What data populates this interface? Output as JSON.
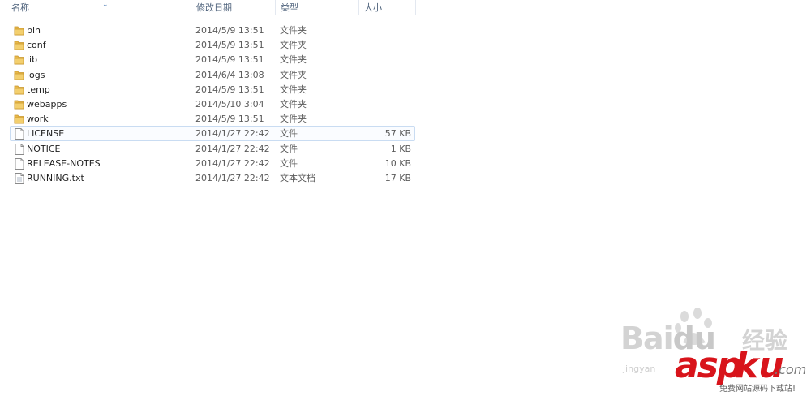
{
  "columns": {
    "name": "名称",
    "date": "修改日期",
    "type": "类型",
    "size": "大小"
  },
  "files": [
    {
      "name": "bin",
      "date": "2014/5/9 13:51",
      "type": "文件夹",
      "size": "",
      "icon": "folder-icon"
    },
    {
      "name": "conf",
      "date": "2014/5/9 13:51",
      "type": "文件夹",
      "size": "",
      "icon": "folder-icon"
    },
    {
      "name": "lib",
      "date": "2014/5/9 13:51",
      "type": "文件夹",
      "size": "",
      "icon": "folder-icon"
    },
    {
      "name": "logs",
      "date": "2014/6/4 13:08",
      "type": "文件夹",
      "size": "",
      "icon": "folder-icon"
    },
    {
      "name": "temp",
      "date": "2014/5/9 13:51",
      "type": "文件夹",
      "size": "",
      "icon": "folder-icon"
    },
    {
      "name": "webapps",
      "date": "2014/5/10 3:04",
      "type": "文件夹",
      "size": "",
      "icon": "folder-icon"
    },
    {
      "name": "work",
      "date": "2014/5/9 13:51",
      "type": "文件夹",
      "size": "",
      "icon": "folder-icon"
    },
    {
      "name": "LICENSE",
      "date": "2014/1/27 22:42",
      "type": "文件",
      "size": "57 KB",
      "icon": "file-icon",
      "selected": true
    },
    {
      "name": "NOTICE",
      "date": "2014/1/27 22:42",
      "type": "文件",
      "size": "1 KB",
      "icon": "file-icon"
    },
    {
      "name": "RELEASE-NOTES",
      "date": "2014/1/27 22:42",
      "type": "文件",
      "size": "10 KB",
      "icon": "file-icon"
    },
    {
      "name": "RUNNING.txt",
      "date": "2014/1/27 22:42",
      "type": "文本文档",
      "size": "17 KB",
      "icon": "text-document-icon"
    }
  ],
  "watermark": {
    "baidu": "Bai",
    "baidu_du": "du",
    "jingyan": "经验",
    "jingyan_url": "jingyan",
    "asp": "asp",
    "ku": "ku",
    "com": ".com",
    "tagline": "免费网站源码下载站!"
  },
  "colors": {
    "folder": "#e8b84a",
    "selection_border": "#c9dcf2",
    "header_text": "#4c607a",
    "brand_red": "#d8141b"
  }
}
